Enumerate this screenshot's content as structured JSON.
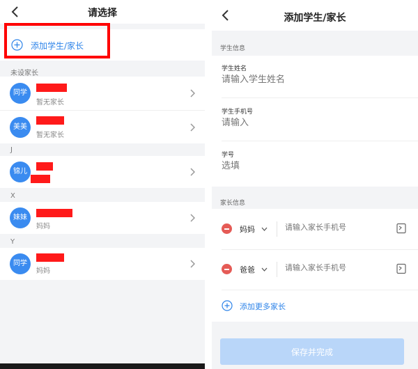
{
  "select_screen": {
    "title": "请选择",
    "add_label": "添加学生/家长",
    "sections": [
      {
        "header": "未设家长",
        "items": [
          {
            "avatar": "同学",
            "subtitle": "暂无家长"
          },
          {
            "avatar": "美美",
            "subtitle": "暂无家长"
          }
        ]
      },
      {
        "header": "J",
        "items": [
          {
            "avatar": "锦儿",
            "subtitle": ""
          }
        ]
      },
      {
        "header": "X",
        "items": [
          {
            "avatar": "妹妹",
            "subtitle": "妈妈"
          }
        ]
      },
      {
        "header": "Y",
        "items": [
          {
            "avatar": "同学",
            "subtitle": "妈妈"
          }
        ]
      }
    ]
  },
  "add_screen": {
    "title": "添加学生/家长",
    "student_section": "学生信息",
    "fields": [
      {
        "label": "学生姓名",
        "placeholder": "请输入学生姓名"
      },
      {
        "label": "学生手机号",
        "placeholder": "请输入"
      },
      {
        "label": "学号",
        "placeholder": "选填"
      }
    ],
    "parent_section": "家长信息",
    "parents": [
      {
        "relation": "妈妈",
        "placeholder": "请输入家长手机号"
      },
      {
        "relation": "爸爸",
        "placeholder": "请输入家长手机号"
      }
    ],
    "add_more_label": "添加更多家长",
    "save_label": "保存并完成"
  },
  "colors": {
    "accent": "#2e84e9",
    "avatar": "#3a8bf0",
    "remove": "#e55b56",
    "highlight": "#ff0000",
    "save_disabled": "#b9d6f9"
  }
}
